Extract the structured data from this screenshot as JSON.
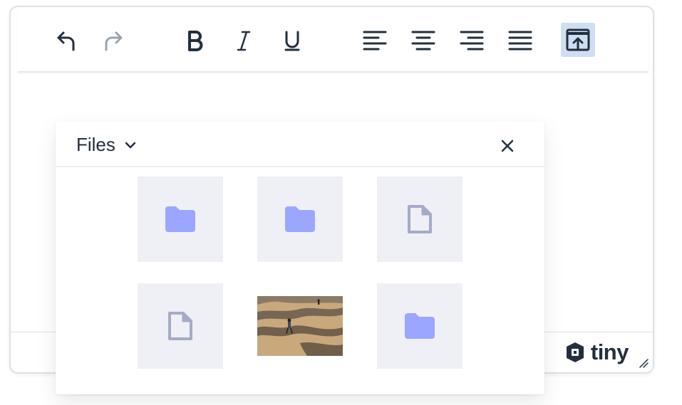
{
  "toolbar": {
    "buttons": [
      {
        "name": "undo",
        "icon": "undo-icon"
      },
      {
        "name": "redo",
        "icon": "redo-icon",
        "disabled": true
      },
      {
        "name": "bold",
        "icon": "bold-icon"
      },
      {
        "name": "italic",
        "icon": "italic-icon"
      },
      {
        "name": "underline",
        "icon": "underline-icon"
      },
      {
        "name": "align-left",
        "icon": "align-left-icon"
      },
      {
        "name": "align-center",
        "icon": "align-center-icon"
      },
      {
        "name": "align-right",
        "icon": "align-right-icon"
      },
      {
        "name": "justify",
        "icon": "align-justify-icon"
      },
      {
        "name": "upload",
        "icon": "upload-icon",
        "active": true
      }
    ]
  },
  "dialog": {
    "title": "Files",
    "close_icon": "close-icon",
    "tiles": [
      {
        "type": "folder",
        "icon": "folder-icon"
      },
      {
        "type": "folder",
        "icon": "folder-icon"
      },
      {
        "type": "file",
        "icon": "file-icon"
      },
      {
        "type": "file",
        "icon": "file-icon"
      },
      {
        "type": "image",
        "icon": "image-thumbnail"
      },
      {
        "type": "folder",
        "icon": "folder-icon"
      }
    ]
  },
  "branding": {
    "text": "tiny",
    "logo_icon": "tiny-logo-icon"
  },
  "colors": {
    "icon_dark": "#222f3e",
    "icon_disabled": "#9aa3ad",
    "active_bg": "#cfdef3",
    "folder": "#9aa6ff",
    "file": "#a5abc4",
    "tile_bg": "#eef0f5"
  }
}
